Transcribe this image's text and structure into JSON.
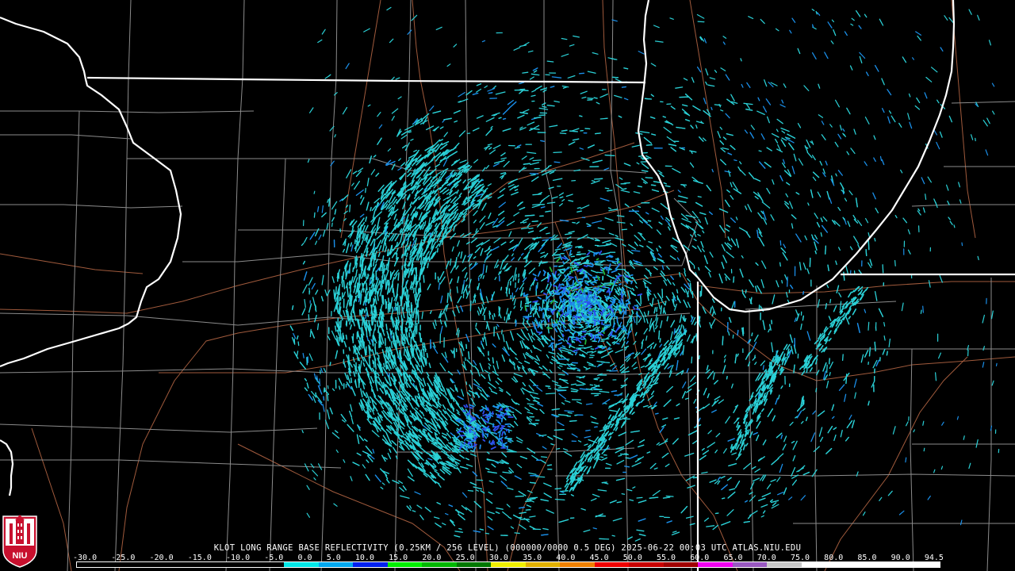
{
  "product_caption": "KLOT LONG RANGE BASE REFLECTIVITY (0.25KM / 256 LEVEL) (000000/0000 0.5 DEG) 2025-06-22 00:03 UTC  ATLAS.NIU.EDU",
  "logo_text": "NIU",
  "legend": {
    "labels": [
      "-30.0",
      "-25.0",
      "-20.0",
      "-15.0",
      "-10.0",
      "-5.0",
      "0.0",
      "5.0",
      "10.0",
      "15.0",
      "20.0",
      "25.0",
      "30.0",
      "35.0",
      "40.0",
      "45.0",
      "50.0",
      "55.0",
      "60.0",
      "65.0",
      "70.0",
      "75.0",
      "80.0",
      "85.0",
      "90.0",
      "94.5"
    ],
    "colors": [
      "#000000",
      "#000000",
      "#000000",
      "#000000",
      "#000000",
      "#000000",
      "#00e8e8",
      "#00a8f0",
      "#0020f0",
      "#00f000",
      "#00b800",
      "#007800",
      "#f0f000",
      "#e0b000",
      "#f08000",
      "#f00000",
      "#c80000",
      "#a00000",
      "#f000f0",
      "#9858c0",
      "#c8c8c8",
      "#ffffff",
      "#ffffff",
      "#ffffff",
      "#ffffff"
    ]
  },
  "map_colors": {
    "state_border": "#ffffff",
    "county_border": "#8c8c8c",
    "roads": "#a05a3c",
    "echo_light": "#2ad0d6",
    "echo_medium": "#1a8ee8",
    "echo_strong": "#2f4ef0",
    "echo_green": "#22b43a"
  }
}
